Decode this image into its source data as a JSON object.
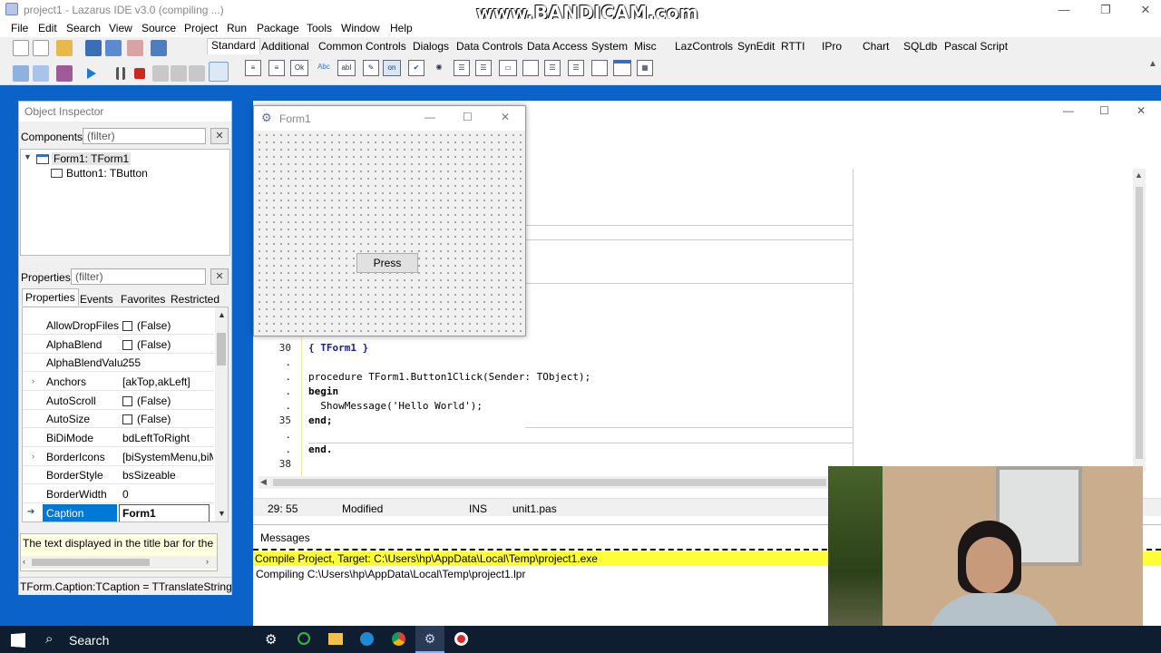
{
  "window": {
    "title": "project1 - Lazarus IDE v3.0 (compiling ...)",
    "watermark": "www.BANDICAM.com",
    "controls": [
      "—",
      "❐",
      "✕"
    ]
  },
  "menu": [
    "File",
    "Edit",
    "Search",
    "View",
    "Source",
    "Project",
    "Run",
    "Package",
    "Tools",
    "Window",
    "Help"
  ],
  "palette_tabs": [
    "Standard",
    "Additional",
    "Common Controls",
    "Dialogs",
    "Data Controls",
    "Data Access",
    "System",
    "Misc",
    "LazControls",
    "SynEdit",
    "RTTI",
    "IPro",
    "Chart",
    "SQLdb",
    "Pascal Script"
  ],
  "object_inspector": {
    "title": "Object Inspector",
    "components_label": "Components",
    "components_filter": "(filter)",
    "tree": [
      "Form1: TForm1",
      "Button1: TButton"
    ],
    "properties_label": "Properties",
    "properties_filter": "(filter)",
    "tabs": [
      "Properties",
      "Events",
      "Favorites",
      "Restricted"
    ],
    "rows": [
      {
        "name": "AllowDropFiles",
        "value": "(False)",
        "check": true
      },
      {
        "name": "AlphaBlend",
        "value": "(False)",
        "check": true
      },
      {
        "name": "AlphaBlendValu",
        "value": "255",
        "check": false
      },
      {
        "name": "Anchors",
        "value": "[akTop,akLeft]",
        "check": false,
        "expand": true
      },
      {
        "name": "AutoScroll",
        "value": "(False)",
        "check": true
      },
      {
        "name": "AutoSize",
        "value": "(False)",
        "check": true
      },
      {
        "name": "BiDiMode",
        "value": "bdLeftToRight",
        "check": false
      },
      {
        "name": "BorderIcons",
        "value": "[biSystemMenu,biMi",
        "check": false,
        "expand": true
      },
      {
        "name": "BorderStyle",
        "value": "bsSizeable",
        "check": false
      },
      {
        "name": "BorderWidth",
        "value": "0",
        "check": false
      },
      {
        "name": "Caption",
        "value": "Form1",
        "check": false,
        "selected": true
      }
    ],
    "hint": "The text displayed in the title bar for the",
    "status": "TForm.Caption:TCaption = TTranslateString ="
  },
  "form1": {
    "title": "Form1",
    "button": "Press"
  },
  "editor": {
    "lines": [
      {
        "num": "30",
        "text": "{ TForm1 }",
        "kind": "comment"
      },
      {
        "num": ".",
        "text": "",
        "kind": "plain"
      },
      {
        "num": ".",
        "text": "procedure TForm1.Button1Click(Sender: TObject);",
        "kind": "proc"
      },
      {
        "num": ".",
        "text": "begin",
        "kind": "kw"
      },
      {
        "num": ".",
        "text": "  ShowMessage('Hello World');",
        "kind": "call"
      },
      {
        "num": "35",
        "text": "end;",
        "kind": "kw"
      },
      {
        "num": ".",
        "text": "",
        "kind": "plain"
      },
      {
        "num": ".",
        "text": "end.",
        "kind": "kw"
      },
      {
        "num": "38",
        "text": "",
        "kind": "plain"
      }
    ],
    "status": {
      "pos": "29: 55",
      "modified": "Modified",
      "mode": "INS",
      "file": "unit1.pas"
    }
  },
  "messages": {
    "title": "Messages",
    "lines": [
      "Compile Project, Target: C:\\Users\\hp\\AppData\\Local\\Temp\\project1.exe",
      "Compiling C:\\Users\\hp\\AppData\\Local\\Temp\\project1.lpr"
    ]
  },
  "taskbar": {
    "search": "Search"
  },
  "colors": {
    "desktop": "#0b63c9",
    "selection": "#0078d7",
    "highlight": "#ffff3a",
    "keyword": "#000000",
    "string": "#1a1aa0",
    "comment": "#1a1aa0"
  }
}
